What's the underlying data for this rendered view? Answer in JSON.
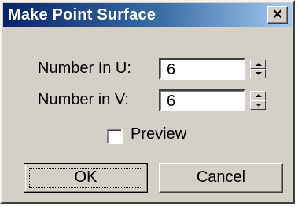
{
  "dialog": {
    "title": "Make Point Surface",
    "close_glyph": "✕",
    "number_u": {
      "label": "Number In U:",
      "value": "6"
    },
    "number_v": {
      "label": "Number in V:",
      "value": "6"
    },
    "preview": {
      "label": "Preview",
      "checked": false
    },
    "ok_label": "OK",
    "cancel_label": "Cancel"
  },
  "colors": {
    "face": "#d4d0c8",
    "title_start": "#0a246a",
    "title_end": "#a6caf0"
  }
}
